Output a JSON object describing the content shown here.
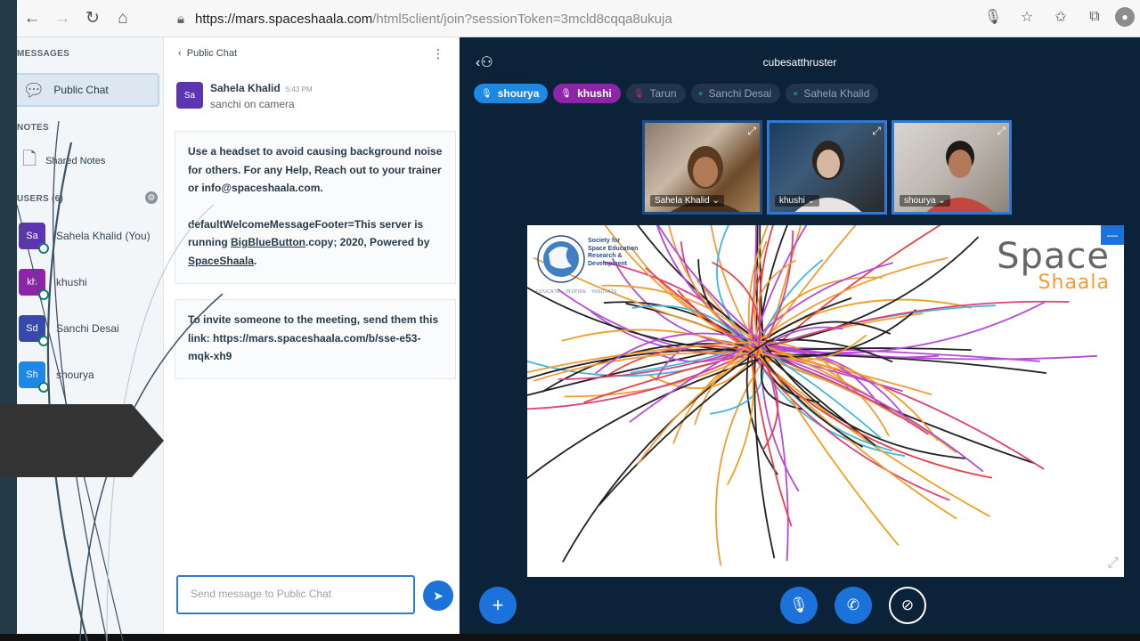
{
  "browser": {
    "url_host": "https://mars.spaceshaala.com",
    "url_path": "/html5client/join?sessionToken=3mcld8cqqa8ukuja"
  },
  "userlist": {
    "messages_heading": "MESSAGES",
    "public_chat_label": "Public Chat",
    "notes_heading": "NOTES",
    "shared_notes_label": "Shared Notes",
    "users_heading": "USERS (6)",
    "users": [
      {
        "initials": "Sa",
        "name": "Sahela Khalid (You)",
        "color": "#5e35b1"
      },
      {
        "initials": "kh",
        "name": "khushi",
        "color": "#8e24aa"
      },
      {
        "initials": "Sd",
        "name": "Sanchi Desai",
        "color": "#3949ab"
      },
      {
        "initials": "Sh",
        "name": "shourya",
        "color": "#1e88e5"
      }
    ]
  },
  "chat": {
    "title": "Public Chat",
    "message": {
      "avatar": "Sa",
      "author": "Sahela Khalid",
      "time": "5:43 PM",
      "text": "sanchi on camera"
    },
    "welcome": {
      "p1": "Use a headset to avoid causing background noise for others. For any Help, Reach out to your trainer or info@spaceshaala.com.",
      "p2_a": "defaultWelcomeMessageFooter=This server is running ",
      "p2_link1": "BigBlueButton",
      "p2_b": ".copy; 2020, Powered by ",
      "p2_link2": "SpaceShaala",
      "p2_c": "."
    },
    "invite": "To invite someone to the meeting, send them this link: https://mars.spaceshaala.com/b/sse-e53-mqk-xh9",
    "input_placeholder": "Send message to Public Chat"
  },
  "meeting": {
    "title": "cubesatthruster",
    "talkers": [
      {
        "name": "shourya",
        "color": "#1e88e5",
        "active": true
      },
      {
        "name": "khushi",
        "color": "#8e24aa",
        "active": true
      },
      {
        "name": "Tarun",
        "color": "#263d5a",
        "active": false
      },
      {
        "name": "Sanchi Desai",
        "color": "#263d5a",
        "active": false
      },
      {
        "name": "Sahela Khalid",
        "color": "#263d5a",
        "active": false
      }
    ],
    "cameras": [
      {
        "name": "Sahela Khalid"
      },
      {
        "name": "khushi"
      },
      {
        "name": "shourya"
      }
    ],
    "whiteboard": {
      "logo_left_text": "Society for Space Education Research & Development",
      "logo_left_tagline": "EDUCATE · INSPIRE · INNOVATE",
      "logo_right_top": "Space",
      "logo_right_bottom": "Shaala"
    },
    "controls": {
      "accent": "#1b72da"
    }
  }
}
